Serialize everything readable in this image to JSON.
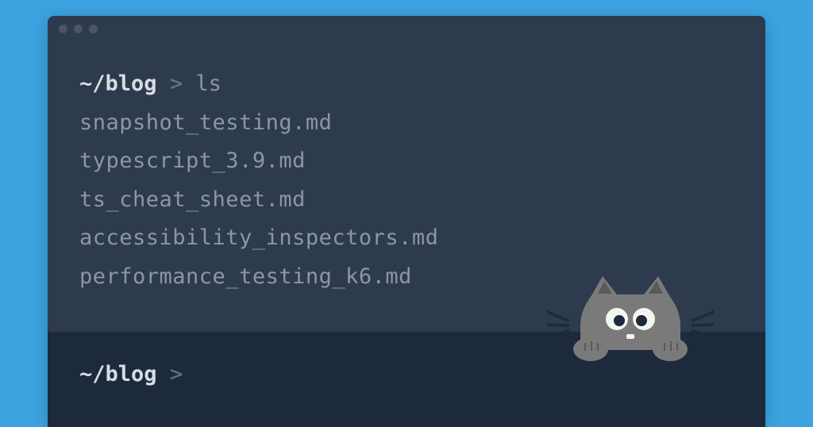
{
  "prompt1": {
    "path": "~/blog",
    "caret": ">",
    "cmd": "ls"
  },
  "output": [
    "snapshot_testing.md",
    "typescript_3.9.md",
    "ts_cheat_sheet.md",
    "accessibility_inspectors.md",
    "performance_testing_k6.md"
  ],
  "prompt2": {
    "path": "~/blog",
    "caret": ">"
  }
}
